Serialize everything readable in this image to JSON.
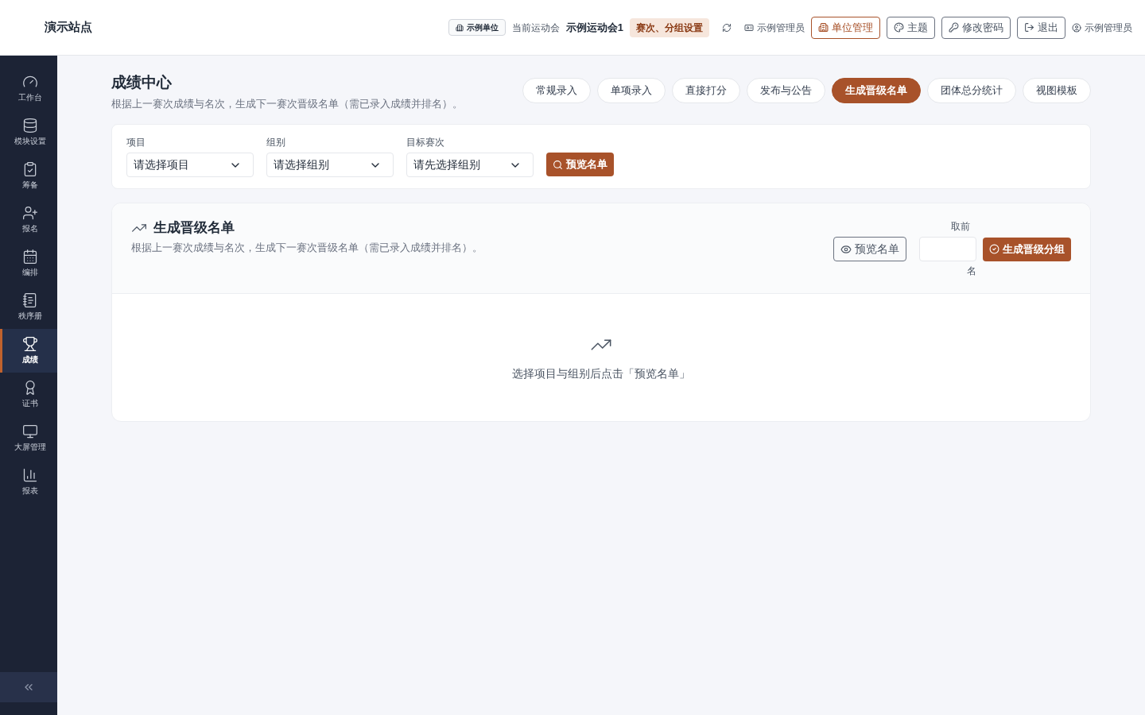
{
  "site_title": "演示站点",
  "header": {
    "unit_badge": "示例单位",
    "current_label": "当前运动会",
    "meet_name": "示例运动会1",
    "settings_tag": "赛次、分组设置",
    "admin_label": "示例管理员",
    "buttons": [
      {
        "kind": "unit",
        "label": "单位管理",
        "selected": true
      },
      {
        "kind": "theme",
        "label": "主题",
        "selected": false
      },
      {
        "kind": "password",
        "label": "修改密码",
        "selected": false
      },
      {
        "kind": "logout",
        "label": "退出",
        "selected": false
      }
    ],
    "user": "示例管理员"
  },
  "sidebar": {
    "items": [
      {
        "kind": "dashboard",
        "label": "工作台",
        "selected": false
      },
      {
        "kind": "modules",
        "label": "模块设置",
        "selected": false
      },
      {
        "kind": "prep",
        "label": "筹备",
        "selected": false
      },
      {
        "kind": "signup",
        "label": "报名",
        "selected": false
      },
      {
        "kind": "schedule",
        "label": "编排",
        "selected": false
      },
      {
        "kind": "booklet",
        "label": "秩序册",
        "selected": false
      },
      {
        "kind": "results",
        "label": "成绩",
        "selected": true
      },
      {
        "kind": "certificate",
        "label": "证书",
        "selected": false
      },
      {
        "kind": "screen",
        "label": "大屏管理",
        "selected": false
      },
      {
        "kind": "reports",
        "label": "报表",
        "selected": false
      }
    ]
  },
  "page": {
    "title": "成绩中心",
    "subtitle": "根据上一赛次成绩与名次，生成下一赛次晋级名单（需已录入成绩并排名）。",
    "tabs": [
      {
        "label": "常规录入",
        "selected": false
      },
      {
        "label": "单项录入",
        "selected": false
      },
      {
        "label": "直接打分",
        "selected": false
      },
      {
        "label": "发布与公告",
        "selected": false
      },
      {
        "label": "生成晋级名单",
        "selected": true
      },
      {
        "label": "团体总分统计",
        "selected": false
      },
      {
        "label": "视图模板",
        "selected": false
      }
    ]
  },
  "filters": {
    "fields": [
      {
        "label": "项目",
        "value": "请选择项目"
      },
      {
        "label": "组别",
        "value": "请选择组别"
      },
      {
        "label": "目标赛次",
        "value": "请先选择组别"
      }
    ],
    "button": "预览名单"
  },
  "panel": {
    "title": "生成晋级名单",
    "description": "根据上一赛次成绩与名次，生成下一赛次晋级名单（需已录入成绩并排名）。",
    "preview_button": "预览名单",
    "top_label": "取前",
    "top_suffix": "名",
    "generate_button": "生成晋级分组",
    "empty_text": "选择项目与组别后点击「预览名单」"
  }
}
